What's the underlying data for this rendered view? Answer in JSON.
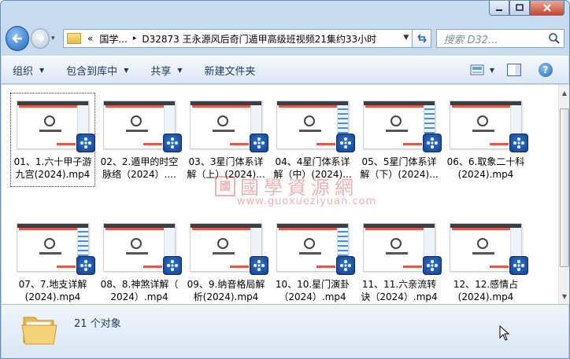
{
  "window": {
    "caption_buttons": [
      "minimize",
      "maximize",
      "close"
    ]
  },
  "nav": {
    "back_icon": "back-arrow-icon",
    "forward_icon": "forward-arrow-icon",
    "history_dropdown": "▾"
  },
  "address": {
    "chevrons": "«",
    "segments": [
      "国学...",
      "D32873 王永源风后奇门遁甲高级班视频21集约33小时"
    ],
    "separator": "▸"
  },
  "search": {
    "placeholder": "搜索 D32..."
  },
  "commands": [
    {
      "label": "组织",
      "dropdown": true
    },
    {
      "label": "包含到库中",
      "dropdown": true
    },
    {
      "label": "共享",
      "dropdown": true
    },
    {
      "label": "新建文件夹",
      "dropdown": false
    }
  ],
  "files": [
    {
      "name": "01、1.六十甲子游九宫(2024).mp4",
      "line1": "01、1.六十甲子游",
      "line2": "九宫(2024).mp4"
    },
    {
      "name": "02、2.遁甲的时空脉络（2024）....",
      "line1": "02、2.遁甲的时空",
      "line2": "脉络（2024）...."
    },
    {
      "name": "03、3星门体系详解（上）(2024)...",
      "line1": "03、3星门体系详",
      "line2": "解（上）(2024)..."
    },
    {
      "name": "04、4星门体系详解（中）(2024)...",
      "line1": "04、4星门体系详",
      "line2": "解（中）(2024)..."
    },
    {
      "name": "05、5星门体系详解（下）(2024)...",
      "line1": "05、5星门体系详",
      "line2": "解（下）(2024)..."
    },
    {
      "name": "06、6.取象二十科(2024).mp4",
      "line1": "06、6.取象二十科",
      "line2": "(2024).mp4"
    },
    {
      "name": "07、7.地支详解(2024).mp4",
      "line1": "07、7.地支详解",
      "line2": "(2024).mp4"
    },
    {
      "name": "08、8.神煞详解（2024）.mp4",
      "line1": "08、8.神煞详解（",
      "line2": "2024）.mp4"
    },
    {
      "name": "09、9.纳音格局解析(2024).mp4",
      "line1": "09、9.纳音格局解",
      "line2": "析(2024).mp4"
    },
    {
      "name": "10、10.星门演卦（2024）.mp4",
      "line1": "10、10.星门演卦",
      "line2": "（2024）.mp4"
    },
    {
      "name": "11、11.六亲流转诀（2024）.mp4",
      "line1": "11、11.六亲流转",
      "line2": "诀（2024）.mp4"
    },
    {
      "name": "12、12.感情占(2024).mp4",
      "line1": "12、12.感情占",
      "line2": "(2024).mp4"
    }
  ],
  "watermark": {
    "seal": "國",
    "text": "國學資源網",
    "url": "www.guoxueziyuan.com"
  },
  "status": {
    "count": "21 个对象"
  },
  "colors": {
    "frame": "#b4cbe6",
    "badge": "#1e55a8",
    "watermark": "#d02020"
  }
}
